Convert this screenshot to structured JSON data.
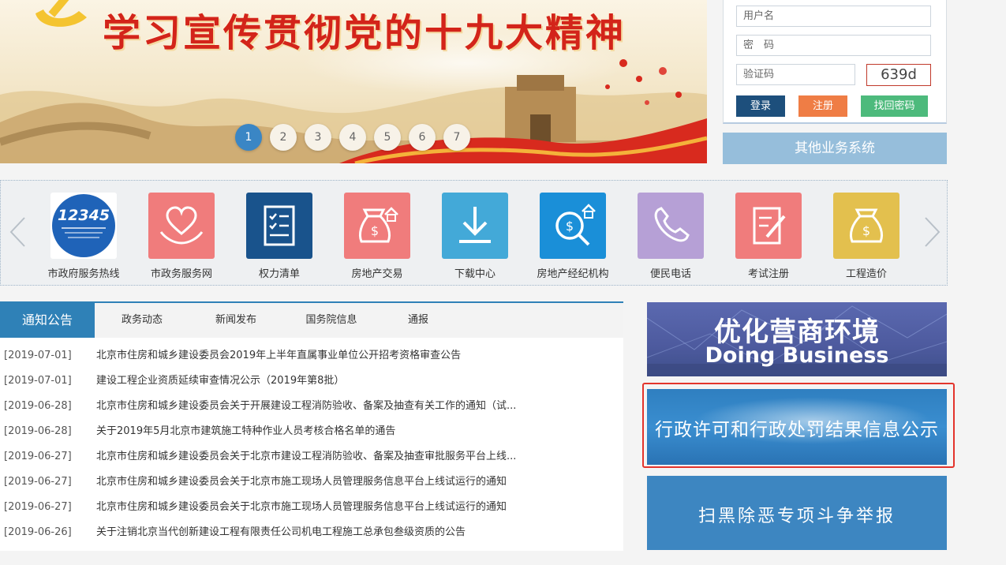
{
  "banner": {
    "title": "学习宣传贯彻党的十九大精神",
    "pages": [
      "1",
      "2",
      "3",
      "4",
      "5",
      "6",
      "7"
    ],
    "active_page": 1
  },
  "login": {
    "username_placeholder": "用户名",
    "password_placeholder": "密　码",
    "captcha_placeholder": "验证码",
    "captcha_code": "639d",
    "login_label": "登录",
    "register_label": "注册",
    "recover_label": "找回密码",
    "other_systems_label": "其他业务系统"
  },
  "services": {
    "prev_icon": "chevron-left-icon",
    "next_icon": "chevron-right-icon",
    "items": [
      {
        "label": "市政府服务热线",
        "icon": "hotline-12345-icon",
        "badge": "12345",
        "color": "#ffffff"
      },
      {
        "label": "市政务服务网",
        "icon": "heart-hand-icon",
        "color": "#f07c7c"
      },
      {
        "label": "权力清单",
        "icon": "checklist-icon",
        "color": "#19538c"
      },
      {
        "label": "房地产交易",
        "icon": "money-bag-house-icon",
        "color": "#f07c7c"
      },
      {
        "label": "下载中心",
        "icon": "download-icon",
        "color": "#43a9d8"
      },
      {
        "label": "房地产经纪机构",
        "icon": "search-money-icon",
        "color": "#1a8fd8"
      },
      {
        "label": "便民电话",
        "icon": "phone-icon",
        "color": "#b6a0d6"
      },
      {
        "label": "考试注册",
        "icon": "exam-edit-icon",
        "color": "#f07c7c"
      },
      {
        "label": "工程造价",
        "icon": "money-bag-icon",
        "color": "#e3c04e"
      }
    ]
  },
  "news": {
    "tabs": [
      "通知公告",
      "政务动态",
      "新闻发布",
      "国务院信息",
      "通报"
    ],
    "active_tab": 0,
    "items": [
      {
        "date": "[2019-07-01]",
        "title": "北京市住房和城乡建设委员会2019年上半年直属事业单位公开招考资格审查公告"
      },
      {
        "date": "[2019-07-01]",
        "title": "建设工程企业资质延续审查情况公示（2019年第8批）"
      },
      {
        "date": "[2019-06-28]",
        "title": "北京市住房和城乡建设委员会关于开展建设工程消防验收、备案及抽查有关工作的通知（试..."
      },
      {
        "date": "[2019-06-28]",
        "title": "关于2019年5月北京市建筑施工特种作业人员考核合格名单的通告"
      },
      {
        "date": "[2019-06-27]",
        "title": "北京市住房和城乡建设委员会关于北京市建设工程消防验收、备案及抽查审批服务平台上线..."
      },
      {
        "date": "[2019-06-27]",
        "title": "北京市住房和城乡建设委员会关于北京市施工现场人员管理服务信息平台上线试运行的通知"
      },
      {
        "date": "[2019-06-27]",
        "title": "北京市住房和城乡建设委员会关于北京市施工现场人员管理服务信息平台上线试运行的通知"
      },
      {
        "date": "[2019-06-26]",
        "title": "关于注销北京当代创新建设工程有限责任公司机电工程施工总承包叁级资质的公告"
      }
    ]
  },
  "promos": {
    "business_cn": "优化营商环境",
    "business_en": "Doing Business",
    "license_penalty": "行政许可和行政处罚结果信息公示",
    "anti_crime": "扫黑除恶专项斗争举报",
    "highlight_color": "#e3342c"
  }
}
